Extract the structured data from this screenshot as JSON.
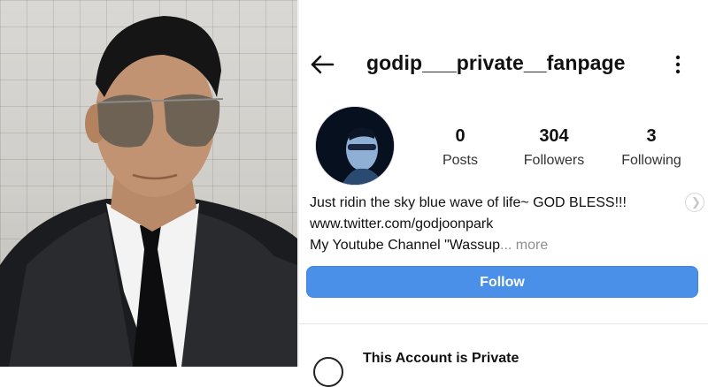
{
  "profile": {
    "username": "godip___private__fanpage",
    "stats": [
      {
        "count": "0",
        "label": "Posts"
      },
      {
        "count": "304",
        "label": "Followers"
      },
      {
        "count": "3",
        "label": "Following"
      }
    ],
    "bio_line1": "Just ridin the sky blue wave of life~ GOD BLESS!!!",
    "bio_link": "www.twitter.com/godjoonpark",
    "bio_line3": "My Youtube Channel \"Wassup",
    "bio_more": "... more"
  },
  "actions": {
    "follow_label": "Follow"
  },
  "private_notice": {
    "title": "This Account is Private"
  },
  "icons": {
    "back": "arrow-left-icon",
    "menu": "more-vertical-icon",
    "expand": "chevron-right-icon",
    "lock": "lock-icon"
  },
  "colors": {
    "follow_button": "#4a8fe8",
    "more_text": "#8e8e8e"
  }
}
